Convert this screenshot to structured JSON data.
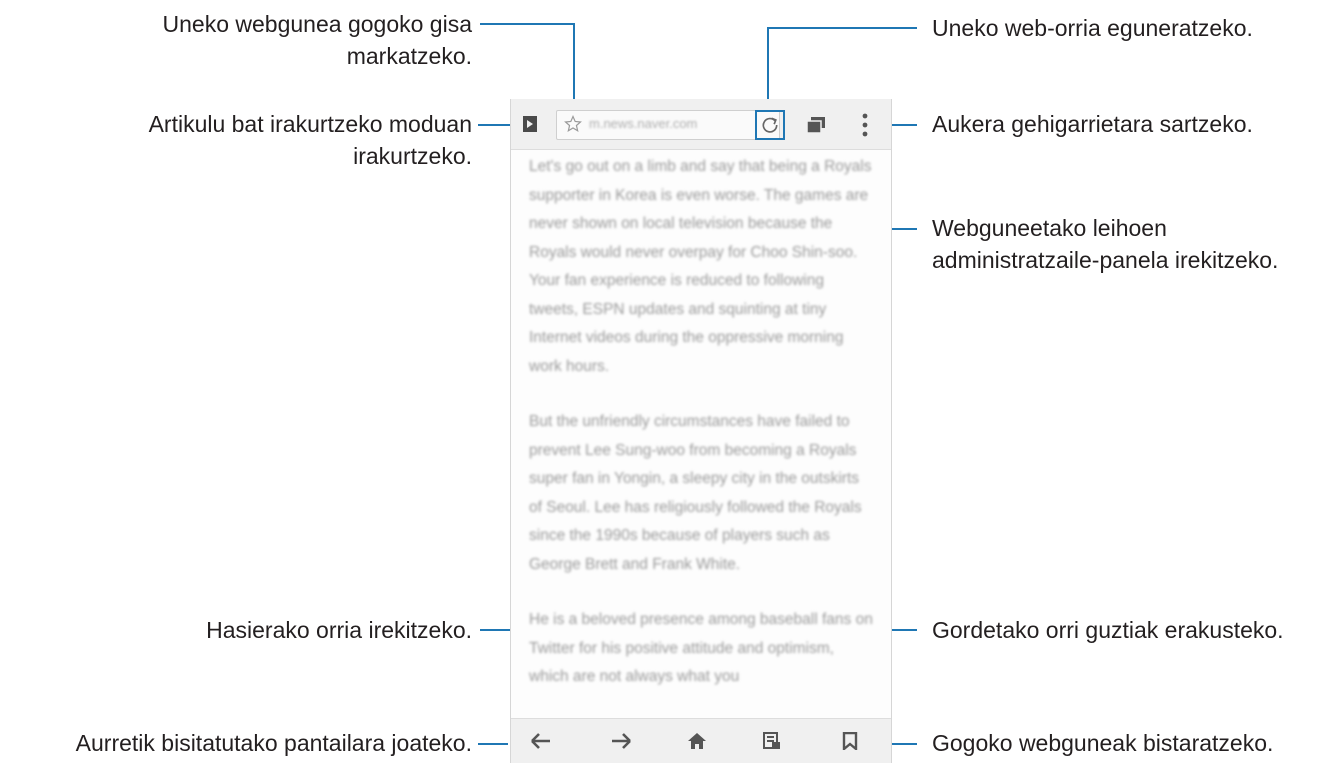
{
  "callouts": {
    "bookmark_page": [
      "Uneko webgunea gogoko gisa",
      "markatzeko."
    ],
    "reader_mode": [
      "Artikulu bat irakurtzeko moduan",
      "irakurtzeko."
    ],
    "refresh": "Uneko web-orria eguneratzeko.",
    "more_options": "Aukera gehigarrietara sartzeko.",
    "window_manager": [
      "Webguneetako leihoen",
      "administratzaile-panela irekitzeko."
    ],
    "home": "Hasierako orria irekitzeko.",
    "saved_pages": "Gordetako orri guztiak erakusteko.",
    "back_forward": "Aurretik bisitatutako pantailara joateko.",
    "bookmarks": "Gogoko webguneak bistaratzeko."
  },
  "browser": {
    "url": "m.news.naver.com",
    "paragraphs": [
      "Let's go out on a limb and say that being a Royals supporter in Korea is even worse. The games are never shown on local television because the Royals would never overpay for Choo Shin-soo. Your fan experience is reduced to following tweets, ESPN updates and squinting at tiny Internet videos during the oppressive morning work hours.",
      "But the unfriendly circumstances have failed to prevent Lee Sung-woo from becoming a Royals super fan in Yongin, a sleepy city in the outskirts of Seoul. Lee has religiously followed the Royals since the 1990s because of players such as George Brett and Frank White.",
      "He is a beloved presence among baseball fans on Twitter for his positive attitude and optimism, which are not always what you"
    ]
  },
  "icons": {
    "reader": "reader-mode-icon",
    "star": "star-icon",
    "refresh": "refresh-icon",
    "windows": "windows-icon",
    "more": "more-options-icon",
    "back": "back-arrow-icon",
    "forward": "forward-arrow-icon",
    "home": "home-icon",
    "saved": "saved-pages-icon",
    "bookmarks": "bookmarks-icon"
  },
  "colors": {
    "callout_line": "#1f77b4"
  }
}
